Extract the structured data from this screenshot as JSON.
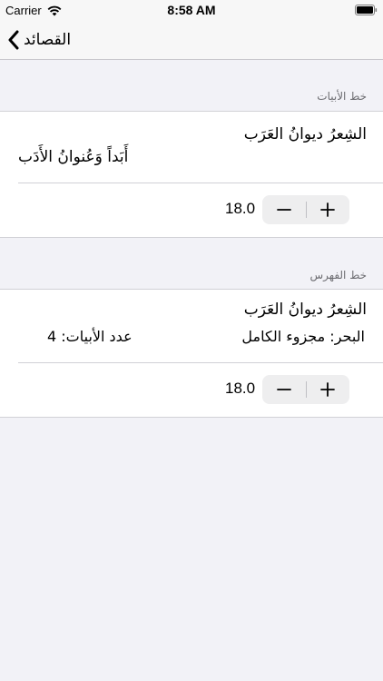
{
  "status_bar": {
    "carrier": "Carrier",
    "time": "8:58 AM",
    "icons": [
      "wifi-icon",
      "battery-icon"
    ]
  },
  "nav": {
    "back_label": "القصائد",
    "back_icon": "chevron-left-icon"
  },
  "verse_font_section": {
    "header": "خط الأبيات",
    "line1": "الشِعرُ ديوانُ العَرَب",
    "line2": "أَبَداً وَعُنوانُ الأَدَب",
    "font_size": "18.0"
  },
  "index_font_section": {
    "header": "خط الفهرس",
    "title": "الشِعرُ ديوانُ العَرَب",
    "meter_label": "البحر:",
    "meter_value": "مجزوء الكامل",
    "count_label": "عدد الأبيات:",
    "count_value": "4",
    "font_size": "18.0"
  },
  "stepper": {
    "decrement_icon": "minus-icon",
    "increment_icon": "plus-icon"
  },
  "colors": {
    "background": "#f2f2f7",
    "card": "#ffffff",
    "header_text": "#6d6d72",
    "separator": "#d1d1d6"
  }
}
